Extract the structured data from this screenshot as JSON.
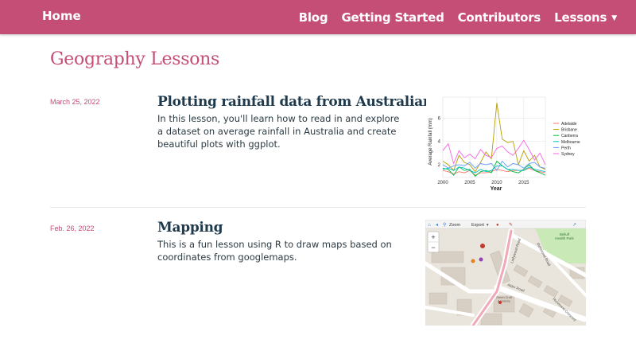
{
  "navbar": {
    "brand": "Home",
    "links": [
      "Blog",
      "Getting Started",
      "Contributors",
      "Lessons"
    ],
    "lessons_caret": "▼"
  },
  "page": {
    "title": "Geography Lessons"
  },
  "lessons": [
    {
      "date": "March 25, 2022",
      "title": "Plotting rainfall data from Australian cities",
      "description": "In this lesson, you'll learn how to read in and explore a dataset on average rainfall in Australia and create beautiful plots with ggplot."
    },
    {
      "date": "Feb. 26, 2022",
      "title": "Mapping",
      "description": "This is a fun lesson using R to draw maps based on coordinates from googlemaps."
    }
  ],
  "colors": {
    "accent": "#c44e76",
    "heading": "#1f3a4d"
  },
  "chart_data": {
    "type": "line",
    "xlabel": "Year",
    "ylabel": "Average Rainfall (mm)",
    "xlim": [
      2000,
      2019
    ],
    "ylim": [
      0.9,
      7.8
    ],
    "xticks": [
      2000,
      2005,
      2010,
      2015
    ],
    "yticks": [
      2,
      4,
      6
    ],
    "grid": true,
    "legend_position": "right",
    "series": [
      {
        "name": "Adelaide",
        "color": "#f8766d",
        "x": [
          2000,
          2001,
          2002,
          2003,
          2004,
          2005,
          2006,
          2007,
          2008,
          2009,
          2010,
          2011,
          2012,
          2013,
          2014,
          2015,
          2016,
          2017,
          2018,
          2019
        ],
        "y": [
          1.5,
          1.4,
          1.2,
          1.4,
          1.3,
          1.5,
          1.1,
          1.3,
          1.3,
          1.4,
          1.6,
          1.5,
          1.4,
          1.5,
          1.5,
          1.5,
          1.7,
          1.5,
          1.4,
          1.3
        ]
      },
      {
        "name": "Brisbane",
        "color": "#b79f00",
        "x": [
          2000,
          2001,
          2002,
          2003,
          2004,
          2005,
          2006,
          2007,
          2008,
          2009,
          2010,
          2011,
          2012,
          2013,
          2014,
          2015,
          2016,
          2017,
          2018,
          2019
        ],
        "y": [
          2.3,
          2.0,
          1.5,
          2.8,
          2.2,
          2.0,
          1.4,
          2.2,
          3.1,
          2.5,
          7.3,
          4.2,
          3.9,
          4.0,
          2.0,
          3.2,
          2.3,
          2.8,
          1.8,
          1.6
        ]
      },
      {
        "name": "Canberra",
        "color": "#00ba38",
        "x": [
          2000,
          2001,
          2002,
          2003,
          2004,
          2005,
          2006,
          2007,
          2008,
          2009,
          2010,
          2011,
          2012,
          2013,
          2014,
          2015,
          2016,
          2017,
          2018,
          2019
        ],
        "y": [
          1.7,
          1.6,
          1.1,
          1.8,
          1.5,
          1.6,
          1.0,
          1.4,
          1.5,
          1.3,
          2.3,
          1.9,
          1.6,
          1.4,
          1.3,
          1.6,
          2.0,
          1.5,
          1.3,
          1.1
        ]
      },
      {
        "name": "Melbourne",
        "color": "#00bfc4",
        "x": [
          2000,
          2001,
          2002,
          2003,
          2004,
          2005,
          2006,
          2007,
          2008,
          2009,
          2010,
          2011,
          2012,
          2013,
          2014,
          2015,
          2016,
          2017,
          2018,
          2019
        ],
        "y": [
          1.6,
          1.7,
          1.5,
          1.8,
          1.7,
          1.5,
          1.3,
          1.6,
          1.4,
          1.5,
          1.9,
          1.9,
          1.6,
          1.6,
          1.5,
          1.5,
          1.8,
          1.6,
          1.5,
          1.4
        ]
      },
      {
        "name": "Perth",
        "color": "#619cff",
        "x": [
          2000,
          2001,
          2002,
          2003,
          2004,
          2005,
          2006,
          2007,
          2008,
          2009,
          2010,
          2011,
          2012,
          2013,
          2014,
          2015,
          2016,
          2017,
          2018,
          2019
        ],
        "y": [
          2.0,
          1.7,
          1.9,
          2.0,
          1.9,
          2.2,
          1.7,
          2.1,
          2.0,
          2.1,
          1.5,
          2.3,
          1.8,
          2.1,
          2.0,
          1.7,
          2.1,
          2.2,
          1.8,
          1.7
        ]
      },
      {
        "name": "Sydney",
        "color": "#f564e3",
        "x": [
          2000,
          2001,
          2002,
          2003,
          2004,
          2005,
          2006,
          2007,
          2008,
          2009,
          2010,
          2011,
          2012,
          2013,
          2014,
          2015,
          2016,
          2017,
          2018,
          2019
        ],
        "y": [
          3.2,
          3.8,
          2.1,
          3.2,
          2.6,
          2.9,
          2.5,
          3.3,
          2.8,
          2.6,
          3.4,
          3.6,
          3.1,
          2.8,
          3.4,
          4.1,
          3.3,
          2.4,
          3.0,
          2.0
        ]
      }
    ]
  },
  "map": {
    "toolbar": {
      "zoom_label": "Zoom",
      "export_label": "Export"
    },
    "zoom_in": "+",
    "zoom_out": "−",
    "labels": {
      "park": "Bellulf\nHealth Park",
      "road1": "Richmond Road",
      "road2": "Alder Road",
      "road3": "Richmond Crescent",
      "road4": "Ladywood Road",
      "school": "Green Croft\nAcademy"
    }
  }
}
